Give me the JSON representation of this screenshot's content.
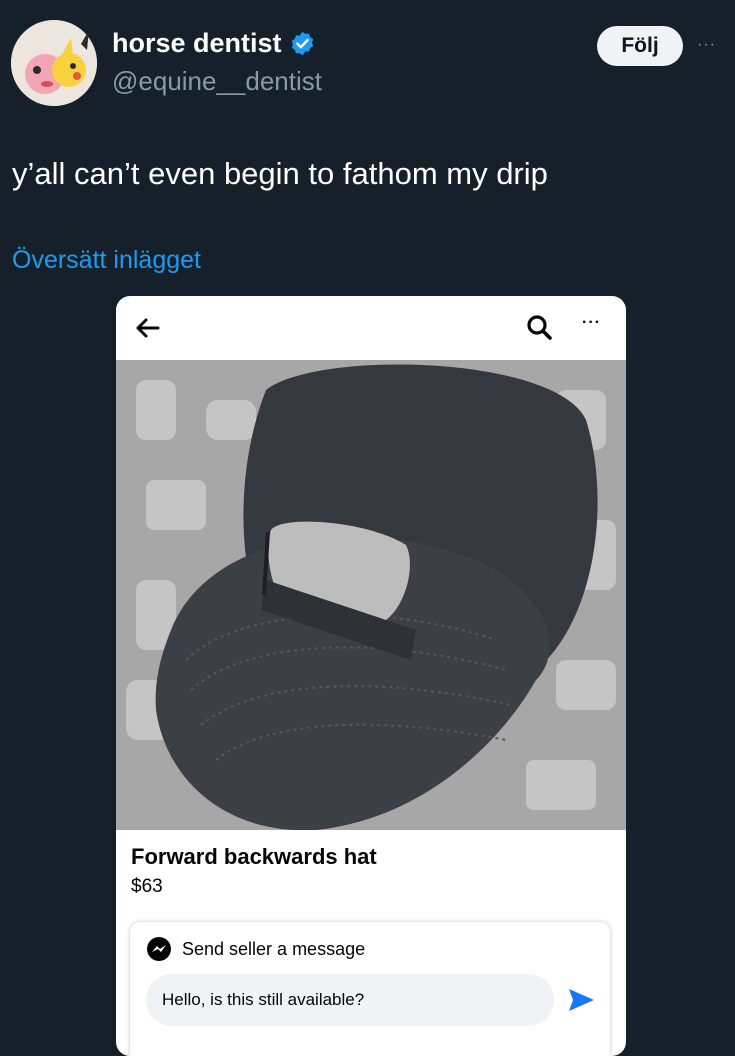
{
  "tweet": {
    "display_name": "horse dentist",
    "handle": "@equine__dentist",
    "follow_label": "Följ",
    "more_label": "···",
    "text": "y’all can’t even begin to fathom my drip",
    "translate_label": "Översätt inlägget"
  },
  "listing": {
    "title": "Forward backwards hat",
    "price": "$63",
    "more_label": "···",
    "message_label": "Send seller a message",
    "message_value": "Hello, is this still available?"
  },
  "colors": {
    "background": "#15202b",
    "accent_blue": "#1d9bf0",
    "send_blue": "#1877f2"
  },
  "icons": {
    "verified": "verified-badge-icon",
    "back": "back-arrow-icon",
    "search": "search-icon",
    "messenger": "messenger-icon",
    "send": "send-icon"
  }
}
